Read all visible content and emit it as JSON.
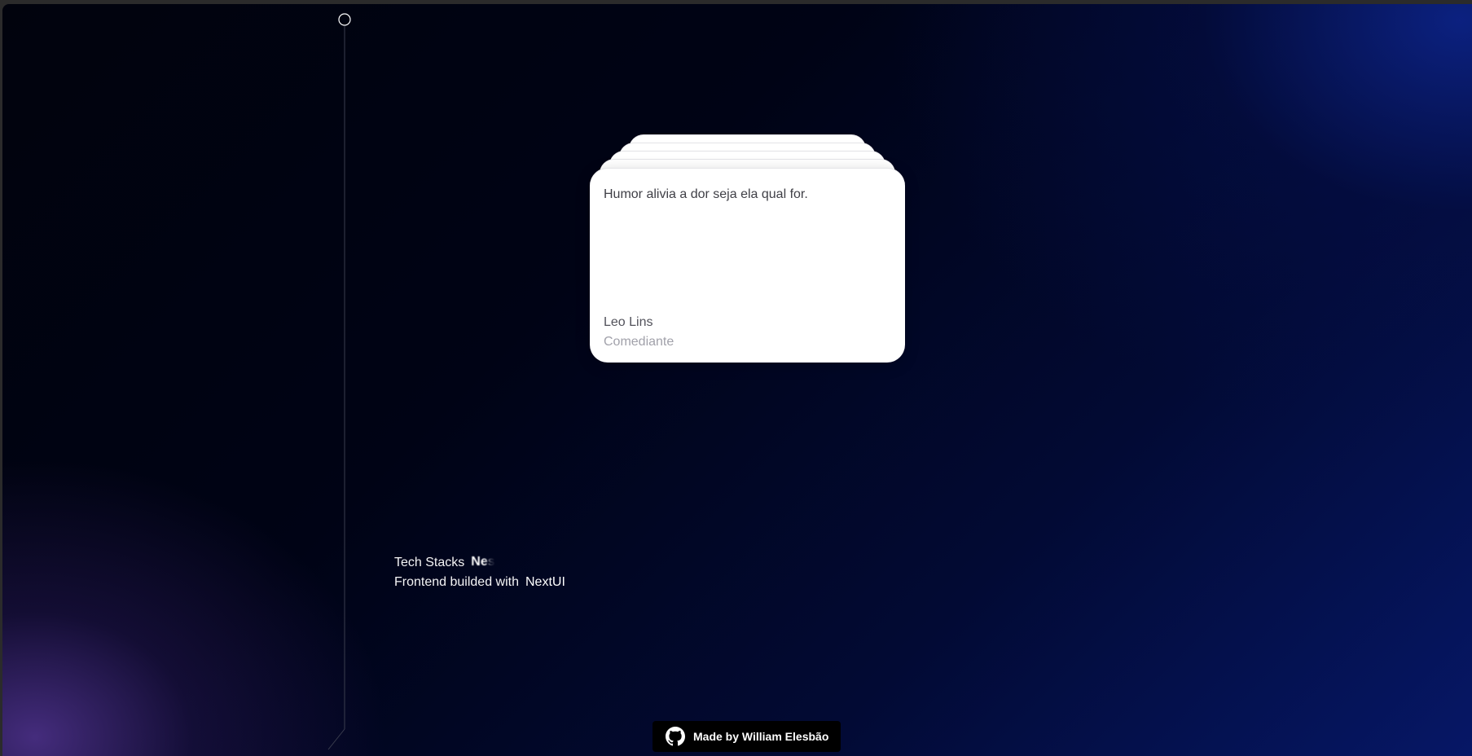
{
  "quote": {
    "text": "Humor alivia a dor seja ela qual for.",
    "author": "Leo Lins",
    "role": "Comediante"
  },
  "tech_info": {
    "stacks_label": "Tech Stacks",
    "stacks_value": "Nes",
    "frontend_label": "Frontend builded with",
    "frontend_value": "NextUI"
  },
  "credit": {
    "label": "Made by William Elesbão",
    "icon": "github-icon"
  },
  "colors": {
    "background_dark": "#000315",
    "background_accent_blue": "#061766",
    "background_accent_purple": "#5f3ca5",
    "card": "#ffffff",
    "badge": "#000000"
  }
}
